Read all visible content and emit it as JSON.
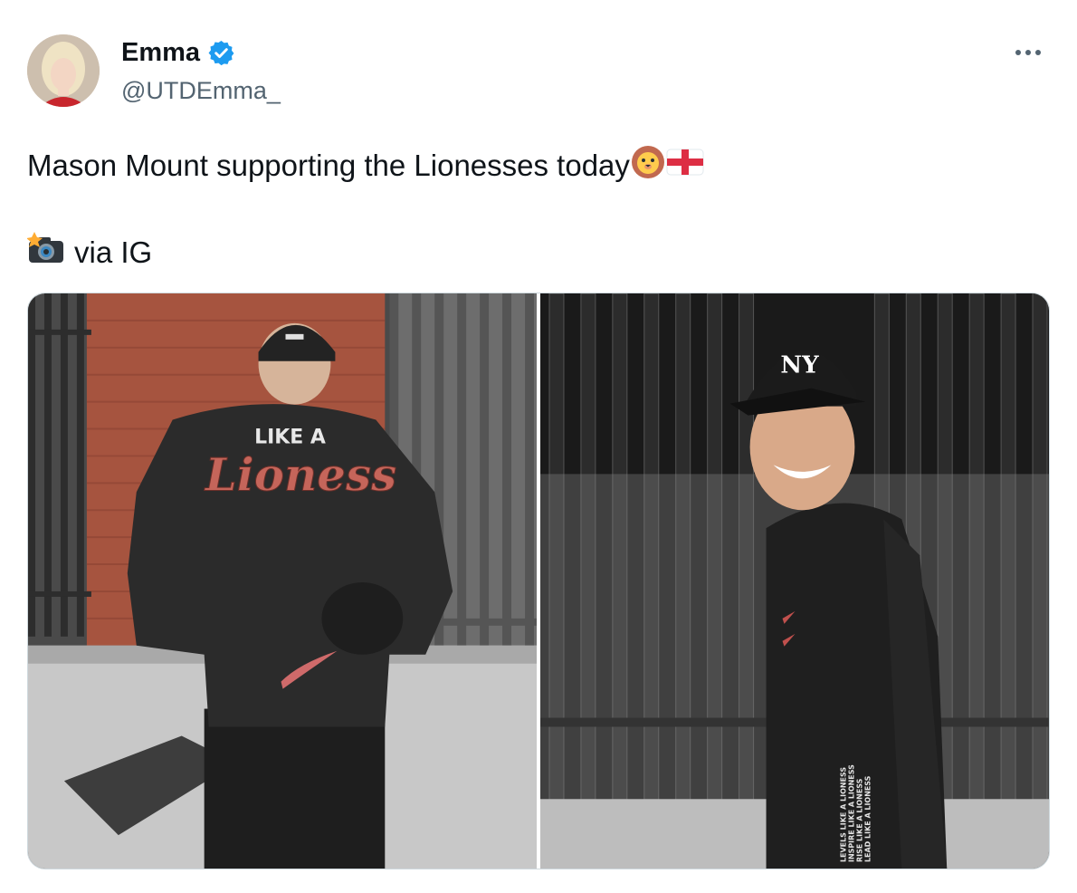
{
  "author": {
    "display_name": "Emma",
    "handle": "@UTDEmma_",
    "verified": true,
    "avatar_icon": "avatar-photo"
  },
  "tweet": {
    "text": "Mason Mount supporting the Lionesses today",
    "emojis": [
      "lion-face-emoji",
      "england-flag-emoji"
    ],
    "via_text": "via IG",
    "via_emoji": "camera-with-flash-emoji"
  },
  "media": {
    "photos": [
      {
        "description_icon": "photo-back-view",
        "shirt_print_top": "LIKE A",
        "shirt_print_main": "Lioness"
      },
      {
        "description_icon": "photo-front-view",
        "sleeve_text": [
          "LEVELS LIKE A LIONESS",
          "INSPIRE LIKE A LIONESS",
          "RISE LIKE A LIONESS",
          "LEAD LIKE A LIONESS"
        ],
        "cap_logo": "NY"
      }
    ]
  },
  "colors": {
    "accent_verified": "#1d9bf0",
    "text_primary": "#0f1419",
    "text_secondary": "#536471"
  }
}
